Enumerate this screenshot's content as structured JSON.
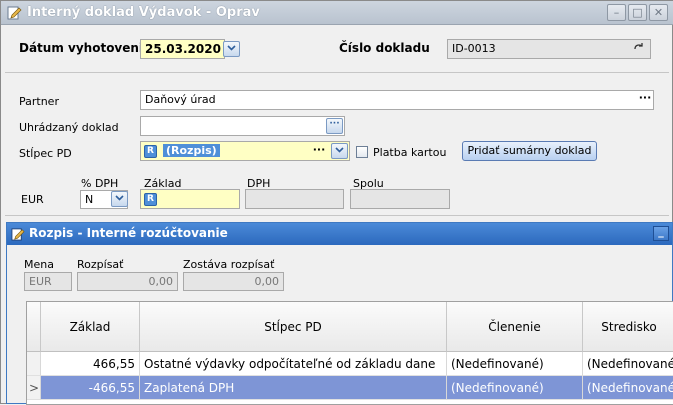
{
  "window": {
    "title": "Interný doklad Výdavok - Oprav",
    "controls": {
      "minimize": "–",
      "maximize": "□",
      "close": "✕"
    }
  },
  "header": {
    "date_label": "Dátum vyhotovenia",
    "date_value": "25.03.2020",
    "doc_number_label": "Číslo dokladu",
    "doc_number_value": "ID-0013"
  },
  "form": {
    "partner_label": "Partner",
    "partner_value": "Daňový úrad",
    "paid_doc_label": "Uhrádzaný doklad",
    "paid_doc_value": "",
    "column_label": "Stĺpec PD",
    "column_value": "(Rozpis)",
    "column_badge": "R",
    "card_payment_label": "Platba kartou",
    "add_summary_button": "Pridať sumárny doklad",
    "currency": "EUR",
    "vat_pct_label": "% DPH",
    "vat_pct_value": "N",
    "base_label": "Základ",
    "base_badge": "R",
    "vat_label": "DPH",
    "total_label": "Spolu"
  },
  "breakdown": {
    "title": "Rozpis - Interné rozúčtovanie",
    "minimize": "_",
    "currency_label": "Mena",
    "currency_value": "EUR",
    "to_split_label": "Rozpísať",
    "to_split_value": "0,00",
    "remaining_label": "Zostáva rozpísať",
    "remaining_value": "0,00",
    "columns": [
      "Základ",
      "Stĺpec PD",
      "Členenie",
      "Stredisko"
    ],
    "rows": [
      {
        "base": "466,55",
        "column": "Ostatné výdavky odpočítateľné od základu dane",
        "category": "(Nedefinované)",
        "center": "(Nedefinované)"
      },
      {
        "base": "-466,55",
        "column": "Zaplatená DPH",
        "category": "(Nedefinované)",
        "center": "(Nedefinované)"
      }
    ],
    "current_row_marker": ">"
  },
  "icons": {
    "app": "edit-document-icon",
    "accent": "#2c69bd",
    "selected_row": "#7e95d6"
  }
}
